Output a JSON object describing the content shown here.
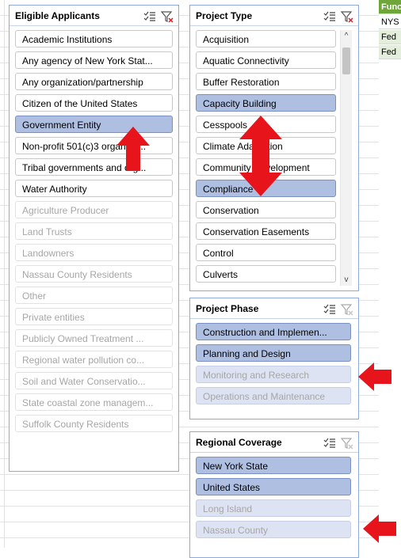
{
  "sheet": {
    "column_header": "Func",
    "cells": [
      "NYS",
      "Fed",
      "Fed"
    ]
  },
  "eligible": {
    "title": "Eligible Applicants",
    "items": [
      {
        "label": "Academic Institutions",
        "state": "available"
      },
      {
        "label": "Any agency of New York Stat...",
        "state": "available"
      },
      {
        "label": "Any organization/partnership",
        "state": "available"
      },
      {
        "label": "Citizen of the United States",
        "state": "available"
      },
      {
        "label": "Government Entity",
        "state": "selected"
      },
      {
        "label": "Non-profit 501(c)3 organiza...",
        "state": "available"
      },
      {
        "label": "Tribal governments and org...",
        "state": "available"
      },
      {
        "label": "Water Authority",
        "state": "available"
      },
      {
        "label": "Agriculture Producer",
        "state": "no-data"
      },
      {
        "label": "Land Trusts",
        "state": "no-data"
      },
      {
        "label": "Landowners",
        "state": "no-data"
      },
      {
        "label": "Nassau County Residents",
        "state": "no-data"
      },
      {
        "label": "Other",
        "state": "no-data"
      },
      {
        "label": "Private entities",
        "state": "no-data"
      },
      {
        "label": "Publicly Owned Treatment ...",
        "state": "no-data"
      },
      {
        "label": "Regional water pollution co...",
        "state": "no-data"
      },
      {
        "label": "Soil and Water Conservatio...",
        "state": "no-data"
      },
      {
        "label": "State coastal zone managem...",
        "state": "no-data"
      },
      {
        "label": "Suffolk County Residents",
        "state": "no-data"
      }
    ]
  },
  "project_type": {
    "title": "Project Type",
    "items": [
      {
        "label": "Acquisition",
        "state": "available"
      },
      {
        "label": "Aquatic Connectivity",
        "state": "available"
      },
      {
        "label": "Buffer Restoration",
        "state": "available"
      },
      {
        "label": "Capacity Building",
        "state": "selected"
      },
      {
        "label": "Cesspools",
        "state": "available"
      },
      {
        "label": "Climate Adaptation",
        "state": "available"
      },
      {
        "label": "Community Development",
        "state": "available"
      },
      {
        "label": "Compliance",
        "state": "selected"
      },
      {
        "label": "Conservation",
        "state": "available"
      },
      {
        "label": "Conservation Easements",
        "state": "available"
      },
      {
        "label": "Control",
        "state": "available"
      },
      {
        "label": "Culverts",
        "state": "available"
      }
    ],
    "scroll_up": "^",
    "scroll_down": "v"
  },
  "project_phase": {
    "title": "Project Phase",
    "items": [
      {
        "label": "Construction and Implemen...",
        "state": "selected"
      },
      {
        "label": "Planning and Design",
        "state": "selected"
      },
      {
        "label": "Monitoring and Research",
        "state": "selected-no-data"
      },
      {
        "label": "Operations and Maintenance",
        "state": "selected-no-data"
      }
    ]
  },
  "regional": {
    "title": "Regional Coverage",
    "items": [
      {
        "label": "New York State",
        "state": "selected"
      },
      {
        "label": "United States",
        "state": "selected"
      },
      {
        "label": "Long Island",
        "state": "selected-no-data"
      },
      {
        "label": "Nassau County",
        "state": "selected-no-data"
      }
    ]
  },
  "icons": {
    "multi_select": "multi-select-icon",
    "clear_filter": "clear-filter-icon"
  },
  "colors": {
    "selected": "#aebfe2",
    "selected_no_data": "#dde3f2",
    "border": "#8eaadb",
    "annotation_arrow": "#e8141b",
    "sheet_header": "#6fa63a"
  }
}
